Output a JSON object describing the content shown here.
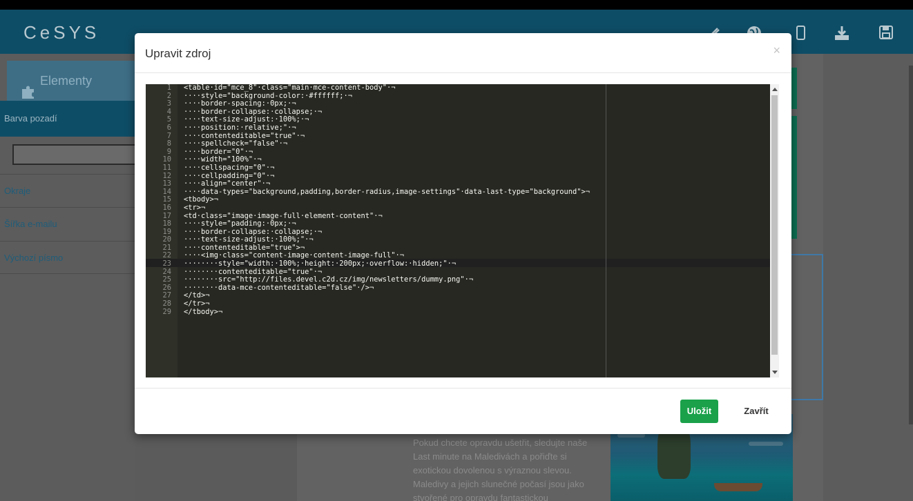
{
  "app": {
    "logo": "CeSYS"
  },
  "sidebar": {
    "tab_label": "Elementy",
    "active_item": "Barva pozadí",
    "items": [
      {
        "label": "Okraje"
      },
      {
        "label": "Šířka e-mailu"
      },
      {
        "label": "Výchozí písmo"
      }
    ]
  },
  "article": {
    "text": "Pokud chcete opravdu ušetřit, sledujte naše Last minute na Maledivách a pořiďte si exotickou dovolenou s výraznou slevou. Maledivy a jejich slunečné počasí jsou jako stvořené pro opravdu fantastickou"
  },
  "modal": {
    "title": "Upravit zdroj",
    "close_symbol": "×",
    "save_label": "Uložit",
    "close_label": "Zavřít"
  },
  "editor": {
    "active_line": 18,
    "lines": [
      {
        "n": "1",
        "code": "<table·id=\"mce_8\"·class=\"main·mce-content-body\"·¬"
      },
      {
        "n": "2",
        "code": "····style=\"background-color:·#ffffff;·¬"
      },
      {
        "n": "3",
        "code": "····border-spacing:·0px;·¬"
      },
      {
        "n": "4",
        "code": "····border-collapse:·collapse;·¬"
      },
      {
        "n": "5",
        "code": "····text-size-adjust:·100%;·¬"
      },
      {
        "n": "6",
        "code": "····position:·relative;\"·¬"
      },
      {
        "n": "7",
        "code": "····contenteditable=\"true\"·¬"
      },
      {
        "n": "8",
        "code": "····spellcheck=\"false\"·¬"
      },
      {
        "n": "9",
        "code": "····border=\"0\"·¬"
      },
      {
        "n": "10",
        "code": "····width=\"100%\"·¬"
      },
      {
        "n": "11",
        "code": "····cellspacing=\"0\"·¬"
      },
      {
        "n": "12",
        "code": "····cellpadding=\"0\"·¬"
      },
      {
        "n": "13",
        "code": "····align=\"center\"·¬"
      },
      {
        "n": "14",
        "code": "····data-types=\"background,padding,border-radius,image-settings\"·data-last-type=\"background\">¬"
      },
      {
        "n": "15",
        "code": "<tbody>¬"
      },
      {
        "n": "16",
        "code": "<tr>¬"
      },
      {
        "n": "17",
        "code": "<td·class=\"image·image-full·element-content\"·¬"
      },
      {
        "n": "18",
        "code": "····style=\"padding:·0px;·¬"
      },
      {
        "n": "19",
        "code": "····border-collapse:·collapse;·¬"
      },
      {
        "n": "20",
        "code": "····text-size-adjust:·100%;\"·¬"
      },
      {
        "n": "21",
        "code": "····contenteditable=\"true\">¬"
      },
      {
        "n": "22",
        "code": "····<img·class=\"content-image·content-image-full\"·¬"
      },
      {
        "n": "23",
        "code": "········style=\"width:·100%;·height:·200px;·overflow:·hidden;\"·¬"
      },
      {
        "n": "24",
        "code": "········contenteditable=\"true\"·¬"
      },
      {
        "n": "25",
        "code": "········src=\"http://files.devel.c2d.cz/img/newsletters/dummy.png\"·¬"
      },
      {
        "n": "26",
        "code": "········data-mce-contenteditable=\"false\"·/>¬"
      },
      {
        "n": "27",
        "code": "</td>¬"
      },
      {
        "n": "28",
        "code": "</tr>¬"
      },
      {
        "n": "29",
        "code": "</tbody>¬"
      }
    ]
  },
  "icons": {
    "header": [
      "pencil-icon",
      "globe-icon",
      "mobile-icon",
      "download-icon",
      "save-icon"
    ],
    "sidebar_tab": "puzzle-icon"
  },
  "colors": {
    "header_bg": "#0e4d66",
    "editor_bg": "#272822",
    "save_button": "#1aa14a"
  }
}
